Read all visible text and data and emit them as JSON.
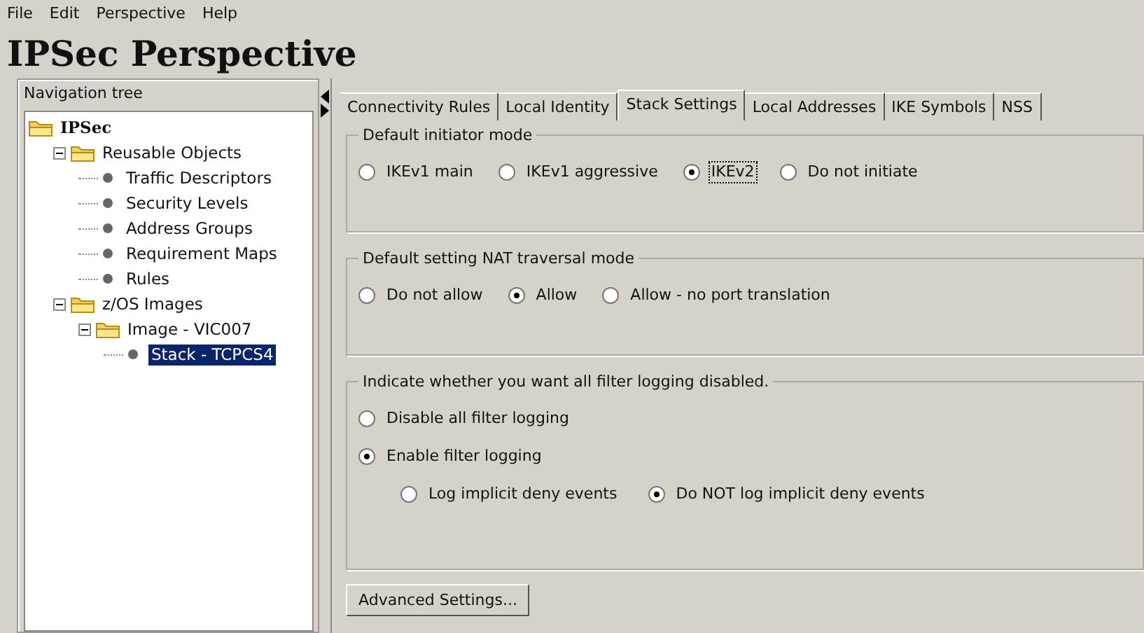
{
  "menu": [
    "File",
    "Edit",
    "Perspective",
    "Help"
  ],
  "title": "IPSec Perspective",
  "navigation": {
    "header": "Navigation tree",
    "tree": [
      {
        "label": "IPSec",
        "kind": "root",
        "children": [
          {
            "label": "Reusable Objects",
            "kind": "folder",
            "expanded": true,
            "children": [
              {
                "label": "Traffic Descriptors",
                "kind": "leaf",
                "selected": false
              },
              {
                "label": "Security Levels",
                "kind": "leaf",
                "selected": false
              },
              {
                "label": "Address Groups",
                "kind": "leaf",
                "selected": false
              },
              {
                "label": "Requirement Maps",
                "kind": "leaf",
                "selected": false
              },
              {
                "label": "Rules",
                "kind": "leaf",
                "selected": false
              }
            ]
          },
          {
            "label": "z/OS Images",
            "kind": "folder",
            "expanded": true,
            "children": [
              {
                "label": "Image - VIC007",
                "kind": "folder",
                "expanded": true,
                "children": [
                  {
                    "label": "Stack - TCPCS4",
                    "kind": "leaf",
                    "selected": true
                  }
                ]
              }
            ]
          }
        ]
      }
    ]
  },
  "tabs": [
    {
      "label": "Connectivity Rules",
      "selected": false
    },
    {
      "label": "Local Identity",
      "selected": false
    },
    {
      "label": "Stack Settings",
      "selected": true
    },
    {
      "label": "Local Addresses",
      "selected": false
    },
    {
      "label": "IKE Symbols",
      "selected": false
    },
    {
      "label": "NSS",
      "selected": false
    }
  ],
  "groups": [
    {
      "title": "Default initiator mode",
      "kind": "row",
      "options": [
        {
          "label": "IKEv1 main",
          "selected": false,
          "focused": false
        },
        {
          "label": "IKEv1 aggressive",
          "selected": false,
          "focused": false
        },
        {
          "label": "IKEv2",
          "selected": true,
          "focused": true
        },
        {
          "label": "Do not initiate",
          "selected": false,
          "focused": false
        }
      ]
    },
    {
      "title": "Default setting NAT traversal mode",
      "kind": "row",
      "options": [
        {
          "label": "Do not allow",
          "selected": false
        },
        {
          "label": "Allow",
          "selected": true
        },
        {
          "label": "Allow - no port translation",
          "selected": false
        }
      ]
    },
    {
      "title": "Indicate whether you want all filter logging disabled.",
      "kind": "column",
      "options": [
        {
          "label": "Disable all filter logging",
          "selected": false
        },
        {
          "label": "Enable filter logging",
          "selected": true
        }
      ],
      "sub_options": [
        {
          "label": "Log implicit deny events",
          "selected": false
        },
        {
          "label": "Do NOT log implicit deny events",
          "selected": true
        }
      ]
    }
  ],
  "button": "Advanced Settings..."
}
